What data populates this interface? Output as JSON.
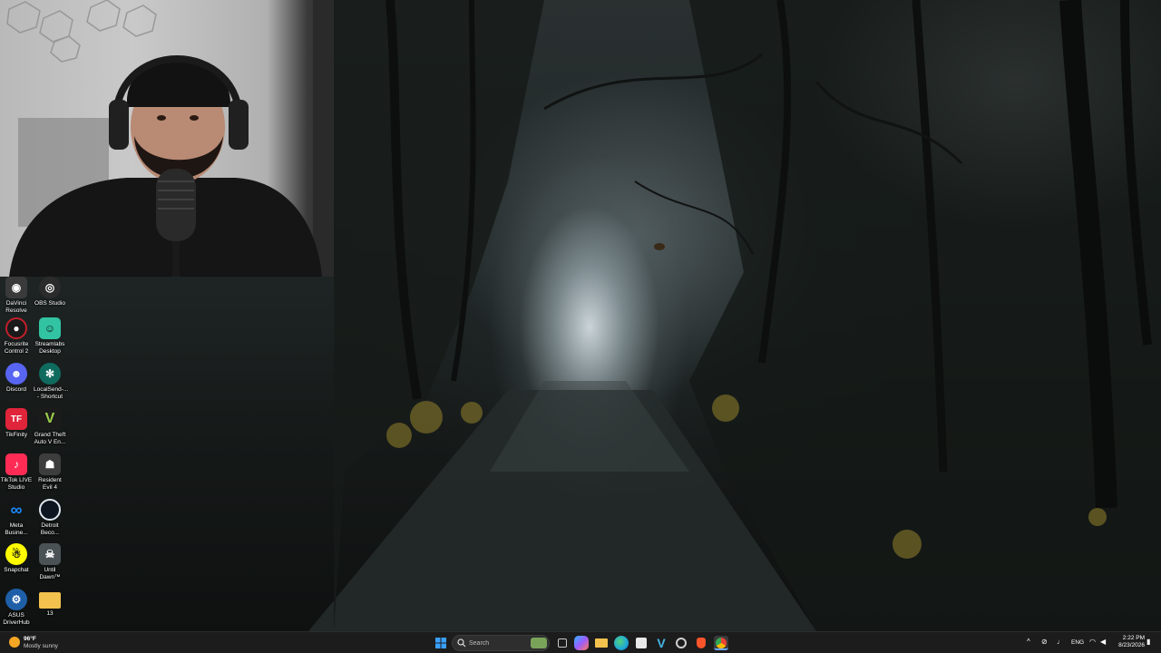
{
  "desktop": {
    "icons": [
      {
        "label": "DaVinci Resolve",
        "icon": "davinci-resolve-icon",
        "color": "#3a3a3a"
      },
      {
        "label": "OBS Studio",
        "icon": "obs-studio-icon",
        "color": "#2b2b2b"
      },
      {
        "label": "Focusrite Control 2",
        "icon": "focusrite-icon",
        "color": "#1a1a1a"
      },
      {
        "label": "Streamlabs Desktop",
        "icon": "streamlabs-icon",
        "color": "#31c3a2"
      },
      {
        "label": "Discord",
        "icon": "discord-icon",
        "color": "#5865f2"
      },
      {
        "label": "LocalSend-...\n- Shortcut",
        "icon": "localsend-icon",
        "color": "#0f6b5e"
      },
      {
        "label": "TikFinity",
        "icon": "tikfinity-icon",
        "color": "#e0243a"
      },
      {
        "label": "Grand Theft Auto V En...",
        "icon": "gta-icon",
        "color": "#1b1b1b"
      },
      {
        "label": "TikTok LIVE Studio",
        "icon": "tiktok-live-icon",
        "color": "#fe2c55"
      },
      {
        "label": "Resident Evil 4",
        "icon": "resident-evil-icon",
        "color": "#3d3d3d"
      },
      {
        "label": "Meta Busine...",
        "icon": "meta-icon",
        "color": "#0a66d6"
      },
      {
        "label": "Detroit Beco...",
        "icon": "detroit-icon",
        "color": "#1d2a3a"
      },
      {
        "label": "Snapchat",
        "icon": "snapchat-icon",
        "color": "#fffc00"
      },
      {
        "label": "Until Dawn™",
        "icon": "until-dawn-icon",
        "color": "#4a5256"
      },
      {
        "label": "ASUS DriverHub",
        "icon": "asus-driverhub-icon",
        "color": "#1e5fa8"
      },
      {
        "label": "13",
        "icon": "folder-icon",
        "color": "#f2c14e"
      }
    ]
  },
  "taskbar": {
    "weather": {
      "temp": "96°F",
      "condition": "Mostly sunny"
    },
    "search_placeholder": "Search",
    "language": "ENG",
    "time": "2:22 PM",
    "date": "8/23/2026",
    "pinned": [
      {
        "name": "start-button",
        "icon": "windows-start-icon",
        "color": "#3aa0ff"
      },
      {
        "name": "task-view-button",
        "icon": "task-view-icon",
        "color": "#9aa0a6"
      },
      {
        "name": "copilot-button",
        "icon": "copilot-icon",
        "color": "#7b61ff"
      },
      {
        "name": "file-explorer-button",
        "icon": "file-explorer-icon",
        "color": "#f2c14e"
      },
      {
        "name": "edge-button",
        "icon": "edge-icon",
        "color": "#1fa7d9"
      },
      {
        "name": "store-button",
        "icon": "microsoft-store-icon",
        "color": "#e9e9e9"
      },
      {
        "name": "vegas-button",
        "icon": "vegas-icon",
        "color": "#46b4e6"
      },
      {
        "name": "settings-button",
        "icon": "app-icon",
        "color": "#d0d0d0"
      },
      {
        "name": "brave-button",
        "icon": "brave-icon",
        "color": "#fb542b"
      },
      {
        "name": "chrome-button",
        "icon": "chrome-icon",
        "color": "#4285f4"
      }
    ]
  }
}
